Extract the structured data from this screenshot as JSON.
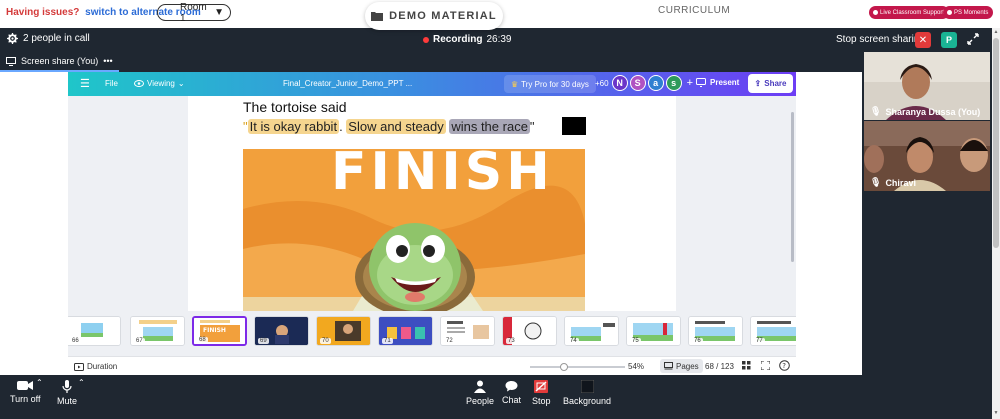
{
  "topbar": {
    "issues_label": "Having issues?",
    "alternate_link": "switch to alternate room",
    "room_value": "Room 1",
    "demo_tab": "DEMO MATERIAL",
    "curriculum": "CURRICULUM",
    "live_support": "Live Classroom Support",
    "ps_moments": "PS Moments"
  },
  "call": {
    "people_count": "2 people in call",
    "recording_label": "Recording",
    "recording_time": "26:39",
    "stop_sharing": "Stop screen sharing",
    "p_badge": "P",
    "share_tab": "Screen share (You)"
  },
  "canva": {
    "file": "File",
    "viewing": "Viewing",
    "doc_title": "Final_Creator_Junior_Demo_PPT ...",
    "try_pro": "Try Pro for 30 days",
    "extra_count": "+60",
    "avatars": [
      "N",
      "S",
      "a",
      "s"
    ],
    "avatar_colors": [
      "#6b35c9",
      "#b052c2",
      "#2f7fd1",
      "#2e9a5a"
    ],
    "present": "Present",
    "share": "Share",
    "slide": {
      "title": "The tortoise said",
      "quote_open": "\"",
      "quote_part1": "It is okay rabbit",
      "quote_part2": ". ",
      "quote_part3": "Slow and steady",
      "quote_part4": " ",
      "quote_part5": "wins the race",
      "quote_close": "\""
    },
    "thumbnail_numbers": [
      "66",
      "67",
      "68",
      "69",
      "70",
      "71",
      "72",
      "73",
      "74",
      "75",
      "76",
      "77"
    ],
    "duration": "Duration",
    "zoom_value": "54%",
    "pages_label": "Pages",
    "page_indicator": "68 / 123"
  },
  "participants": [
    {
      "name": "Sharanya Dussa (You)"
    },
    {
      "name": "Chiravi"
    }
  ],
  "controls": {
    "turn_off": "Turn off",
    "mute": "Mute",
    "people": "People",
    "chat": "Chat",
    "stop": "Stop",
    "background": "Background"
  }
}
